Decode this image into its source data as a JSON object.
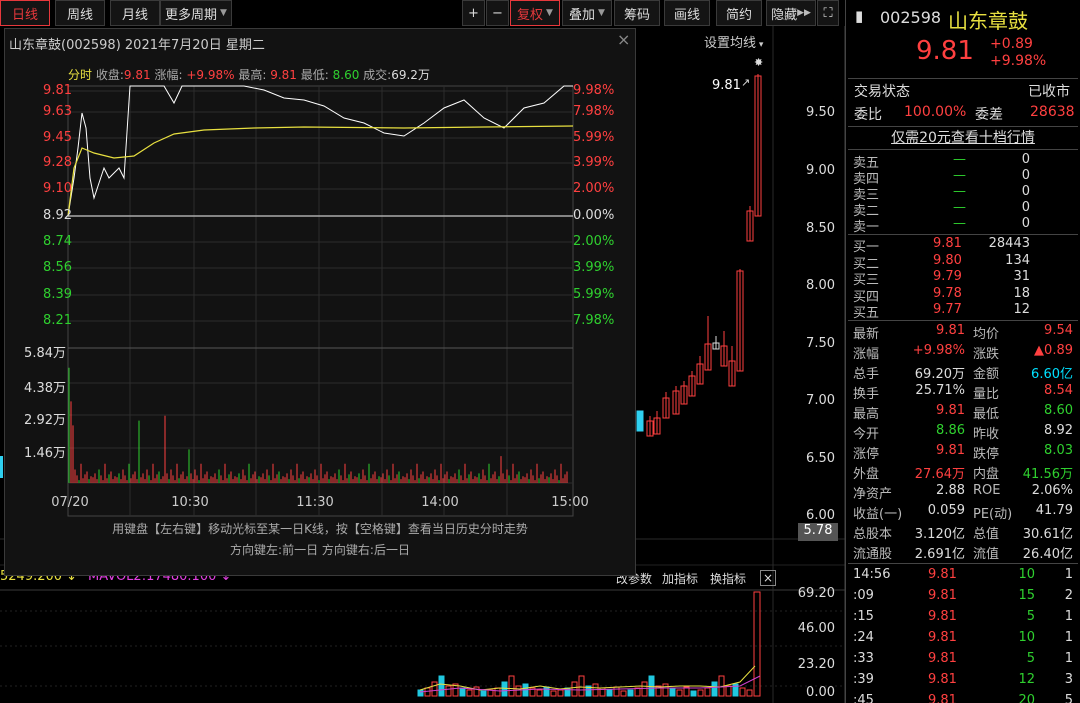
{
  "toolbar": {
    "daily": "日线",
    "weekly": "周线",
    "monthly": "月线",
    "more": "更多周期",
    "plus": "+",
    "minus": "−",
    "fuquan": "复权",
    "overlay": "叠加",
    "chip": "筹码",
    "draw": "画线",
    "simple": "简约",
    "hide": "隐藏"
  },
  "chart": {
    "ma_setting": "设置均线",
    "peak_label": "9.81",
    "price_axis": [
      "9.50",
      "9.00",
      "8.50",
      "8.00",
      "7.50",
      "7.00",
      "6.50",
      "6.00"
    ],
    "current_price_tag": "5.78"
  },
  "volume": {
    "legend": "5249.200",
    "mavol": "MAVOL2:17480.100",
    "tabs": [
      "改参数",
      "加指标",
      "换指标"
    ],
    "axis": [
      "69.20",
      "46.00",
      "23.20",
      "0.00"
    ]
  },
  "popup": {
    "title": "山东章鼓(002598) 2021年7月20日 星期二",
    "close": "×",
    "info": {
      "mode": "分时",
      "close_label": "收盘:",
      "close_val": "9.81",
      "chg_label": "涨幅:",
      "chg_val": "+9.98%",
      "high_label": "最高:",
      "high_val": "9.81",
      "low_label": "最低:",
      "low_val": "8.60",
      "vol_label": "成交:",
      "vol_val": "69.2万"
    },
    "left_prices": [
      "9.81",
      "9.63",
      "9.45",
      "9.28",
      "9.10",
      "8.92",
      "8.74",
      "8.56",
      "8.39",
      "8.21"
    ],
    "right_pcts": [
      "9.98%",
      "7.98%",
      "5.99%",
      "3.99%",
      "2.00%",
      "0.00%",
      "2.00%",
      "3.99%",
      "5.99%",
      "7.98%"
    ],
    "vol_labels": [
      "5.84万",
      "4.38万",
      "2.92万",
      "1.46万"
    ],
    "times": [
      "07/20",
      "10:30",
      "11:30",
      "14:00",
      "15:00"
    ],
    "hint1": "用键盘【左右键】移动光标至某一日K线，按【空格键】查看当日历史分时走势",
    "hint2": "方向键左:前一日  方向键右:后一日"
  },
  "stock": {
    "code": "002598",
    "name": "山东章鼓",
    "price": "9.81",
    "change": "+0.89",
    "pct": "+9.98%",
    "status_label": "交易状态",
    "status": "已收市",
    "wb_label": "委比",
    "wb": "100.00%",
    "wc_label": "委差",
    "wc": "28638",
    "link": "仅需20元查看十档行情"
  },
  "asks": [
    {
      "label": "卖五",
      "price": "—",
      "vol": "0"
    },
    {
      "label": "卖四",
      "price": "—",
      "vol": "0"
    },
    {
      "label": "卖三",
      "price": "—",
      "vol": "0"
    },
    {
      "label": "卖二",
      "price": "—",
      "vol": "0"
    },
    {
      "label": "卖一",
      "price": "—",
      "vol": "0"
    }
  ],
  "bids": [
    {
      "label": "买一",
      "price": "9.81",
      "vol": "28443"
    },
    {
      "label": "买二",
      "price": "9.80",
      "vol": "134"
    },
    {
      "label": "买三",
      "price": "9.79",
      "vol": "31"
    },
    {
      "label": "买四",
      "price": "9.78",
      "vol": "18"
    },
    {
      "label": "买五",
      "price": "9.77",
      "vol": "12"
    }
  ],
  "stats": [
    {
      "l1": "最新",
      "v1": "9.81",
      "c1": "red",
      "l2": "均价",
      "v2": "9.54",
      "c2": "red"
    },
    {
      "l1": "涨幅",
      "v1": "+9.98%",
      "c1": "red",
      "l2": "涨跌",
      "v2": "▲0.89",
      "c2": "red"
    },
    {
      "l1": "总手",
      "v1": "69.20万",
      "c1": "wht",
      "l2": "金额",
      "v2": "6.60亿",
      "c2": "cy"
    },
    {
      "l1": "换手",
      "v1": "25.71%",
      "c1": "wht",
      "l2": "量比",
      "v2": "8.54",
      "c2": "red"
    },
    {
      "l1": "最高",
      "v1": "9.81",
      "c1": "red",
      "l2": "最低",
      "v2": "8.60",
      "c2": "grn"
    },
    {
      "l1": "今开",
      "v1": "8.86",
      "c1": "grn",
      "l2": "昨收",
      "v2": "8.92",
      "c2": "wht"
    },
    {
      "l1": "涨停",
      "v1": "9.81",
      "c1": "red",
      "l2": "跌停",
      "v2": "8.03",
      "c2": "grn"
    },
    {
      "l1": "外盘",
      "v1": "27.64万",
      "c1": "red",
      "l2": "内盘",
      "v2": "41.56万",
      "c2": "grn"
    },
    {
      "l1": "净资产",
      "v1": "2.88",
      "c1": "wht",
      "l2": "ROE",
      "v2": "2.06%",
      "c2": "wht"
    },
    {
      "l1": "收益(一)",
      "v1": "0.059",
      "c1": "wht",
      "l2": "PE(动)",
      "v2": "41.79",
      "c2": "wht"
    },
    {
      "l1": "总股本",
      "v1": "3.120亿",
      "c1": "wht",
      "l2": "总值",
      "v2": "30.61亿",
      "c2": "wht"
    },
    {
      "l1": "流通股",
      "v1": "2.691亿",
      "c1": "wht",
      "l2": "流值",
      "v2": "26.40亿",
      "c2": "wht"
    }
  ],
  "ticks": [
    {
      "t": "14:56",
      "p": "9.81",
      "v": "10",
      "n": "1"
    },
    {
      "t": ":09",
      "p": "9.81",
      "v": "15",
      "n": "2"
    },
    {
      "t": ":15",
      "p": "9.81",
      "v": "5",
      "n": "1"
    },
    {
      "t": ":24",
      "p": "9.81",
      "v": "10",
      "n": "1"
    },
    {
      "t": ":33",
      "p": "9.81",
      "v": "5",
      "n": "1"
    },
    {
      "t": ":39",
      "p": "9.81",
      "v": "12",
      "n": "3"
    },
    {
      "t": ":45",
      "p": "9.81",
      "v": "20",
      "n": "5"
    }
  ],
  "colors": {
    "up": "#ff4040",
    "down": "#2fd02f",
    "accent": "#e6383c",
    "avg_line": "#e8e040",
    "price_line": "#ffffff",
    "bg": "#000000"
  }
}
